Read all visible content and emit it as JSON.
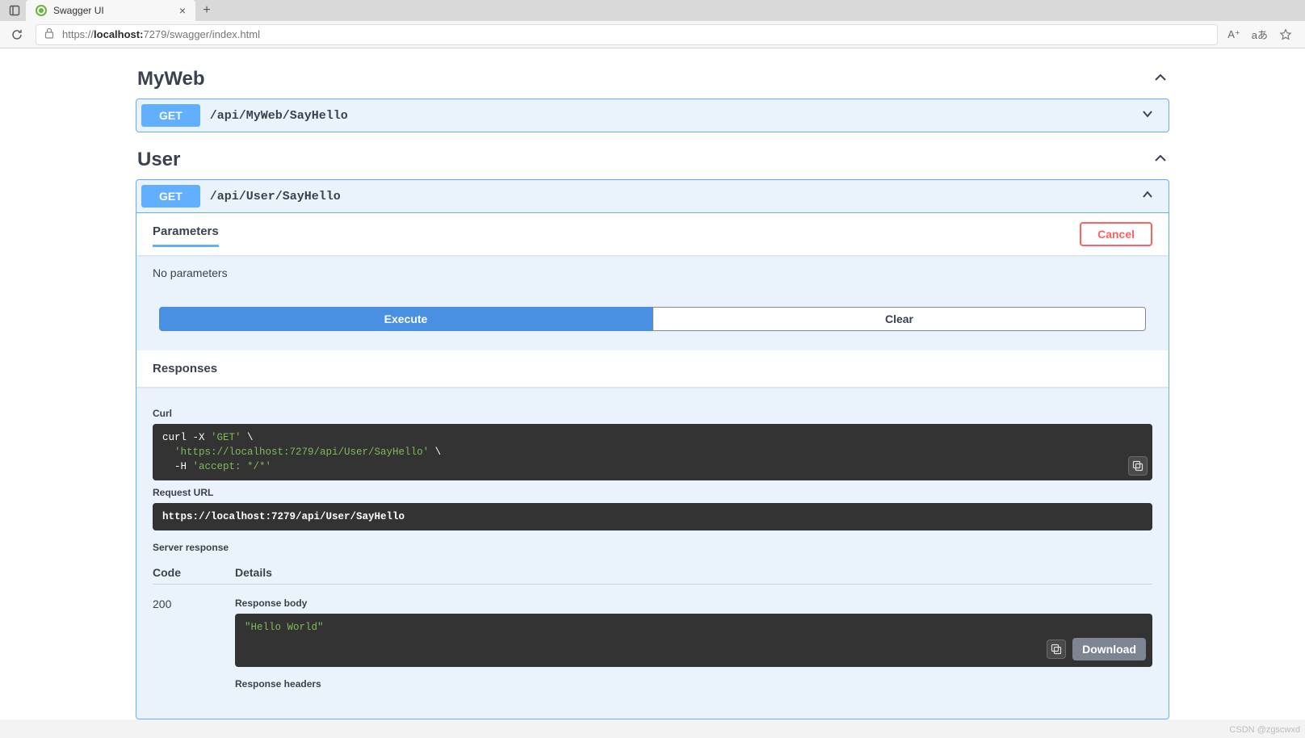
{
  "browser": {
    "tab_title": "Swagger UI",
    "url_host": "localhost:",
    "url_prefix": "https://",
    "url_port_path": "7279/swagger/index.html",
    "toolbar_read": "A⁺",
    "toolbar_translate": "aあ"
  },
  "tags": [
    {
      "name": "MyWeb"
    },
    {
      "name": "User"
    }
  ],
  "ops": {
    "myweb": {
      "method": "GET",
      "path": "/api/MyWeb/SayHello"
    },
    "user": {
      "method": "GET",
      "path": "/api/User/SayHello"
    }
  },
  "labels": {
    "parameters": "Parameters",
    "no_params": "No parameters",
    "cancel": "Cancel",
    "execute": "Execute",
    "clear": "Clear",
    "responses": "Responses",
    "curl": "Curl",
    "request_url": "Request URL",
    "server_response": "Server response",
    "code": "Code",
    "details": "Details",
    "response_body": "Response body",
    "response_headers": "Response headers",
    "download": "Download"
  },
  "curl": {
    "l1a": "curl -X ",
    "l1b": "'GET'",
    "l1c": " \\",
    "l2a": "  ",
    "l2b": "'https://localhost:7279/api/User/SayHello'",
    "l2c": " \\",
    "l3a": "  -H ",
    "l3b": "'accept: */*'"
  },
  "request_url": "https://localhost:7279/api/User/SayHello",
  "response": {
    "code": "200",
    "body": "\"Hello World\""
  },
  "watermark": "CSDN @zgscwxd"
}
